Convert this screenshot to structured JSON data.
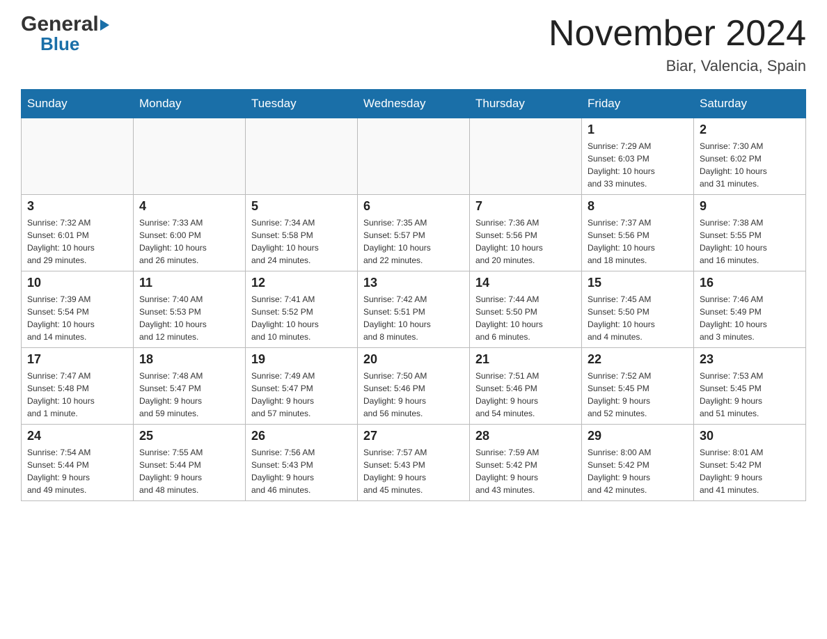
{
  "header": {
    "month_year": "November 2024",
    "location": "Biar, Valencia, Spain",
    "logo_general": "General",
    "logo_blue": "Blue"
  },
  "weekdays": [
    "Sunday",
    "Monday",
    "Tuesday",
    "Wednesday",
    "Thursday",
    "Friday",
    "Saturday"
  ],
  "weeks": [
    [
      {
        "day": "",
        "info": ""
      },
      {
        "day": "",
        "info": ""
      },
      {
        "day": "",
        "info": ""
      },
      {
        "day": "",
        "info": ""
      },
      {
        "day": "",
        "info": ""
      },
      {
        "day": "1",
        "info": "Sunrise: 7:29 AM\nSunset: 6:03 PM\nDaylight: 10 hours\nand 33 minutes."
      },
      {
        "day": "2",
        "info": "Sunrise: 7:30 AM\nSunset: 6:02 PM\nDaylight: 10 hours\nand 31 minutes."
      }
    ],
    [
      {
        "day": "3",
        "info": "Sunrise: 7:32 AM\nSunset: 6:01 PM\nDaylight: 10 hours\nand 29 minutes."
      },
      {
        "day": "4",
        "info": "Sunrise: 7:33 AM\nSunset: 6:00 PM\nDaylight: 10 hours\nand 26 minutes."
      },
      {
        "day": "5",
        "info": "Sunrise: 7:34 AM\nSunset: 5:58 PM\nDaylight: 10 hours\nand 24 minutes."
      },
      {
        "day": "6",
        "info": "Sunrise: 7:35 AM\nSunset: 5:57 PM\nDaylight: 10 hours\nand 22 minutes."
      },
      {
        "day": "7",
        "info": "Sunrise: 7:36 AM\nSunset: 5:56 PM\nDaylight: 10 hours\nand 20 minutes."
      },
      {
        "day": "8",
        "info": "Sunrise: 7:37 AM\nSunset: 5:56 PM\nDaylight: 10 hours\nand 18 minutes."
      },
      {
        "day": "9",
        "info": "Sunrise: 7:38 AM\nSunset: 5:55 PM\nDaylight: 10 hours\nand 16 minutes."
      }
    ],
    [
      {
        "day": "10",
        "info": "Sunrise: 7:39 AM\nSunset: 5:54 PM\nDaylight: 10 hours\nand 14 minutes."
      },
      {
        "day": "11",
        "info": "Sunrise: 7:40 AM\nSunset: 5:53 PM\nDaylight: 10 hours\nand 12 minutes."
      },
      {
        "day": "12",
        "info": "Sunrise: 7:41 AM\nSunset: 5:52 PM\nDaylight: 10 hours\nand 10 minutes."
      },
      {
        "day": "13",
        "info": "Sunrise: 7:42 AM\nSunset: 5:51 PM\nDaylight: 10 hours\nand 8 minutes."
      },
      {
        "day": "14",
        "info": "Sunrise: 7:44 AM\nSunset: 5:50 PM\nDaylight: 10 hours\nand 6 minutes."
      },
      {
        "day": "15",
        "info": "Sunrise: 7:45 AM\nSunset: 5:50 PM\nDaylight: 10 hours\nand 4 minutes."
      },
      {
        "day": "16",
        "info": "Sunrise: 7:46 AM\nSunset: 5:49 PM\nDaylight: 10 hours\nand 3 minutes."
      }
    ],
    [
      {
        "day": "17",
        "info": "Sunrise: 7:47 AM\nSunset: 5:48 PM\nDaylight: 10 hours\nand 1 minute."
      },
      {
        "day": "18",
        "info": "Sunrise: 7:48 AM\nSunset: 5:47 PM\nDaylight: 9 hours\nand 59 minutes."
      },
      {
        "day": "19",
        "info": "Sunrise: 7:49 AM\nSunset: 5:47 PM\nDaylight: 9 hours\nand 57 minutes."
      },
      {
        "day": "20",
        "info": "Sunrise: 7:50 AM\nSunset: 5:46 PM\nDaylight: 9 hours\nand 56 minutes."
      },
      {
        "day": "21",
        "info": "Sunrise: 7:51 AM\nSunset: 5:46 PM\nDaylight: 9 hours\nand 54 minutes."
      },
      {
        "day": "22",
        "info": "Sunrise: 7:52 AM\nSunset: 5:45 PM\nDaylight: 9 hours\nand 52 minutes."
      },
      {
        "day": "23",
        "info": "Sunrise: 7:53 AM\nSunset: 5:45 PM\nDaylight: 9 hours\nand 51 minutes."
      }
    ],
    [
      {
        "day": "24",
        "info": "Sunrise: 7:54 AM\nSunset: 5:44 PM\nDaylight: 9 hours\nand 49 minutes."
      },
      {
        "day": "25",
        "info": "Sunrise: 7:55 AM\nSunset: 5:44 PM\nDaylight: 9 hours\nand 48 minutes."
      },
      {
        "day": "26",
        "info": "Sunrise: 7:56 AM\nSunset: 5:43 PM\nDaylight: 9 hours\nand 46 minutes."
      },
      {
        "day": "27",
        "info": "Sunrise: 7:57 AM\nSunset: 5:43 PM\nDaylight: 9 hours\nand 45 minutes."
      },
      {
        "day": "28",
        "info": "Sunrise: 7:59 AM\nSunset: 5:42 PM\nDaylight: 9 hours\nand 43 minutes."
      },
      {
        "day": "29",
        "info": "Sunrise: 8:00 AM\nSunset: 5:42 PM\nDaylight: 9 hours\nand 42 minutes."
      },
      {
        "day": "30",
        "info": "Sunrise: 8:01 AM\nSunset: 5:42 PM\nDaylight: 9 hours\nand 41 minutes."
      }
    ]
  ],
  "colors": {
    "header_bg": "#1a6fa8",
    "header_text": "#ffffff",
    "border": "#999999",
    "cell_border": "#bbbbbb"
  }
}
